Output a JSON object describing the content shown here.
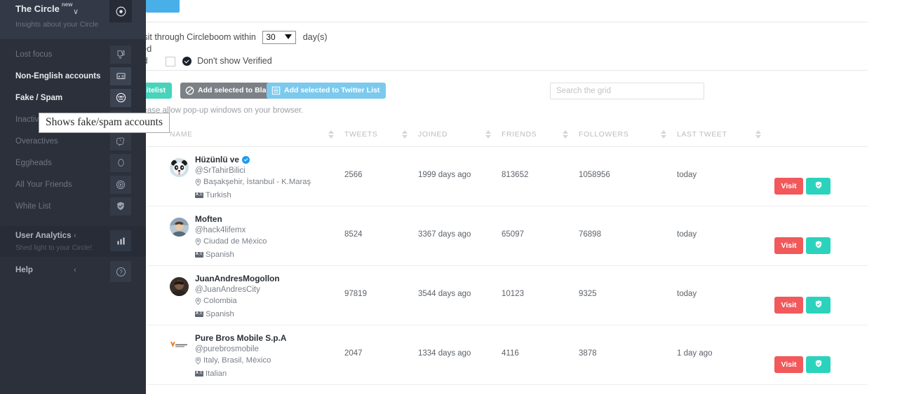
{
  "sidebar": {
    "brand": {
      "title": "The Circle",
      "badge": "new",
      "subtitle": "Insights about your Circle",
      "chevron": "∨",
      "head_icon": "target-icon"
    },
    "items": [
      {
        "label": "Lost focus",
        "icon": "thumbs-down-icon",
        "active": false
      },
      {
        "label": "Non-English accounts",
        "icon": "translate-icon",
        "active": true
      },
      {
        "label": "Fake / Spam",
        "icon": "robot-face-icon",
        "active": true
      },
      {
        "label": "Inactives",
        "icon": "clock-icon",
        "active": false
      },
      {
        "label": "Overactives",
        "icon": "brain-icon",
        "active": false
      },
      {
        "label": "Eggheads",
        "icon": "egg-icon",
        "active": false
      },
      {
        "label": "All Your Friends",
        "icon": "target-icon",
        "active": false
      },
      {
        "label": "White List",
        "icon": "shield-check-icon",
        "active": false
      }
    ],
    "analytics": {
      "label": "User Analytics",
      "arrow": "‹",
      "subtitle": "Shed light to your Circle!",
      "icon": "bar-chart-icon"
    },
    "help": {
      "label": "Help",
      "arrow": "‹",
      "icon": "question-circle-icon"
    }
  },
  "tooltip": {
    "text": "Shows fake/spam accounts"
  },
  "filters": {
    "line1_before": "om I paid a visit through Circleboom within",
    "days_value": "30",
    "line1_after": "day(s)",
    "line2": "de White Listed",
    "line3_before": "w only Verified",
    "line3_after": "Don't show Verified",
    "checkbox_checked": false
  },
  "actions": {
    "whitelist_label": "o Whitelist",
    "blacklist_label": "Add selected to Blacklist",
    "twitterlist_label": "Add selected to Twitter List",
    "blacklist_icon": "ban-icon",
    "twitterlist_icon": "list-icon",
    "note": "isit a profile, please allow pop-up windows on your browser."
  },
  "search": {
    "placeholder": "Search the grid",
    "value": ""
  },
  "grid": {
    "columns": [
      "NAME",
      "TWEETS",
      "JOINED",
      "FRIENDS",
      "FOLLOWERS",
      "LAST TWEET"
    ],
    "row_buttons": {
      "visit": "Visit",
      "whitelist_icon": "shield-check-icon"
    },
    "rows": [
      {
        "name": "Hüzünlü ve",
        "verified": true,
        "handle": "@SrTahirBilici",
        "location": "Başakşehir, İstanbul - K.Maraş",
        "language": "Turkish",
        "tweets": "2566",
        "joined": "1999 days ago",
        "friends": "813652",
        "followers": "1058956",
        "last_tweet": "today",
        "avatar": "panda"
      },
      {
        "name": "Moften",
        "verified": false,
        "handle": "@hack4lifemx",
        "location": "Ciudad de México",
        "language": "Spanish",
        "tweets": "8524",
        "joined": "3367 days ago",
        "friends": "65097",
        "followers": "76898",
        "last_tweet": "today",
        "avatar": "person-light"
      },
      {
        "name": "JuanAndresMogollon",
        "verified": false,
        "handle": "@JuanAndresCity",
        "location": "Colombia",
        "language": "Spanish",
        "tweets": "97819",
        "joined": "3544 days ago",
        "friends": "10123",
        "followers": "9325",
        "last_tweet": "today",
        "avatar": "person-dark"
      },
      {
        "name": "Pure Bros Mobile S.p.A",
        "verified": false,
        "handle": "@purebrosmobile",
        "location": "Italy, Brasil, Mèxico",
        "language": "Italian",
        "tweets": "2047",
        "joined": "1334 days ago",
        "friends": "4116",
        "followers": "3878",
        "last_tweet": "1 day ago",
        "avatar": "logo"
      }
    ]
  },
  "colors": {
    "sidebar_bg": "#2b303b",
    "accent_teal": "#2bd3bd",
    "accent_red": "#f1595b",
    "accent_blue": "#7cc9ee",
    "tab_blue": "#49afe9",
    "grey_btn": "#7b8186"
  }
}
